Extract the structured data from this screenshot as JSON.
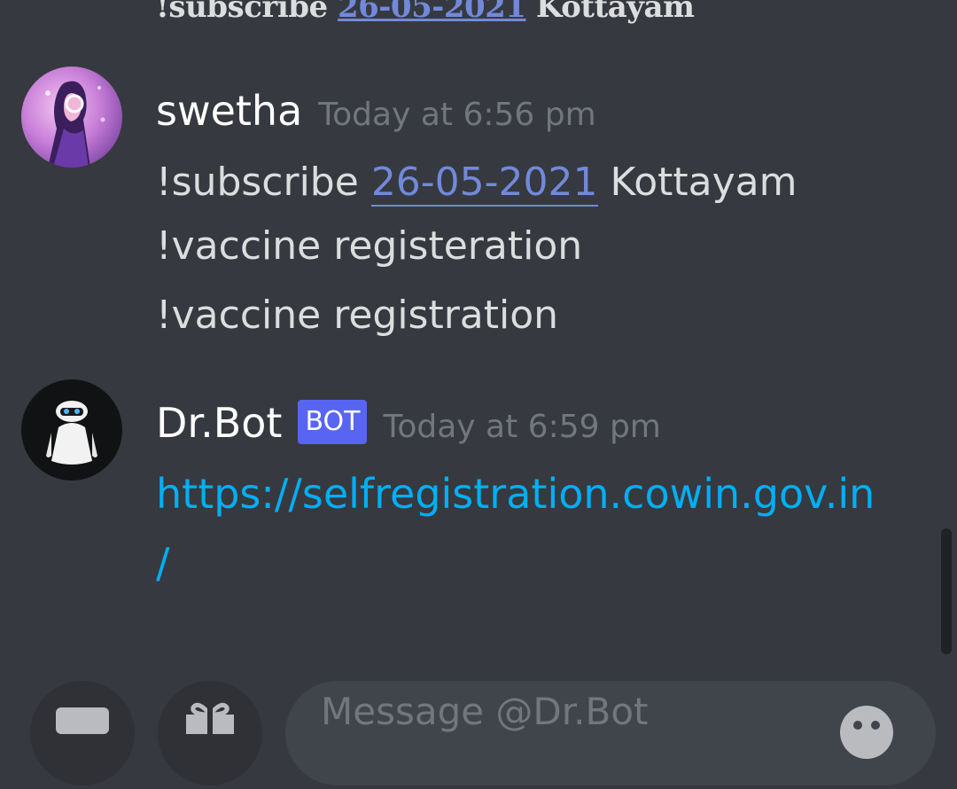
{
  "previous_message": {
    "prefix": "!subscribe",
    "date": "26-05-2021",
    "suffix": "Kottayam"
  },
  "messages": [
    {
      "username": "swetha",
      "timestamp": "Today at 6:56 pm",
      "lines": [
        {
          "prefix": "!subscribe",
          "date": "26-05-2021",
          "suffix": "Kottayam"
        },
        {
          "text": "!vaccine registeration"
        },
        {
          "text": "!vaccine registration"
        }
      ]
    },
    {
      "username": "Dr.Bot",
      "badge": "BOT",
      "timestamp": "Today at 6:59 pm",
      "link_line1": "https://selfregistration.cowin.gov.in",
      "link_line2": "/"
    }
  ],
  "composer": {
    "placeholder": "Message @Dr.Bot"
  },
  "icons": [
    "image-icon",
    "gift-icon",
    "emoji-icon"
  ]
}
